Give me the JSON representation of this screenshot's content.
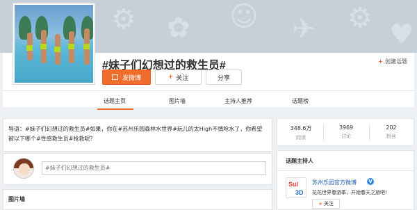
{
  "topic": {
    "title": "#妹子们幻想过的救生员#",
    "create_label": "创建话题",
    "post_label": "发微博",
    "follow_label": "关注",
    "share_label": "分享"
  },
  "tabs": [
    {
      "label": "话题主页",
      "active": true
    },
    {
      "label": "图片墙",
      "active": false
    },
    {
      "label": "主持人推荐",
      "active": false
    },
    {
      "label": "话题榜",
      "active": false
    }
  ],
  "guide": {
    "text": "导语：#妹子们幻想过的救生员#如果，你在#苏州乐园森林水世界#玩儿的太High不慎呛水了，你希望被以下哪个#性感救生员#抢救呢？"
  },
  "compose": {
    "placeholder": "#妹子们幻想过的救生员#"
  },
  "gallery": {
    "title": "图片墙"
  },
  "stats": [
    {
      "num": "348.6万",
      "label": "阅读"
    },
    {
      "num": "3969",
      "label": "讨论"
    },
    {
      "num": "202",
      "label": "粉丝"
    }
  ],
  "host": {
    "title": "话题主持人",
    "name": "苏州乐园官方微博",
    "verified_mark": "V",
    "desc": "花花世界春游季，开始春天之旅吧!",
    "follow_label": "关注",
    "logo_top": "Sul",
    "logo_bottom": "3D"
  },
  "colors": {
    "accent": "#f06d2e",
    "link": "#1f5fa8",
    "verified": "#2d87e3"
  }
}
